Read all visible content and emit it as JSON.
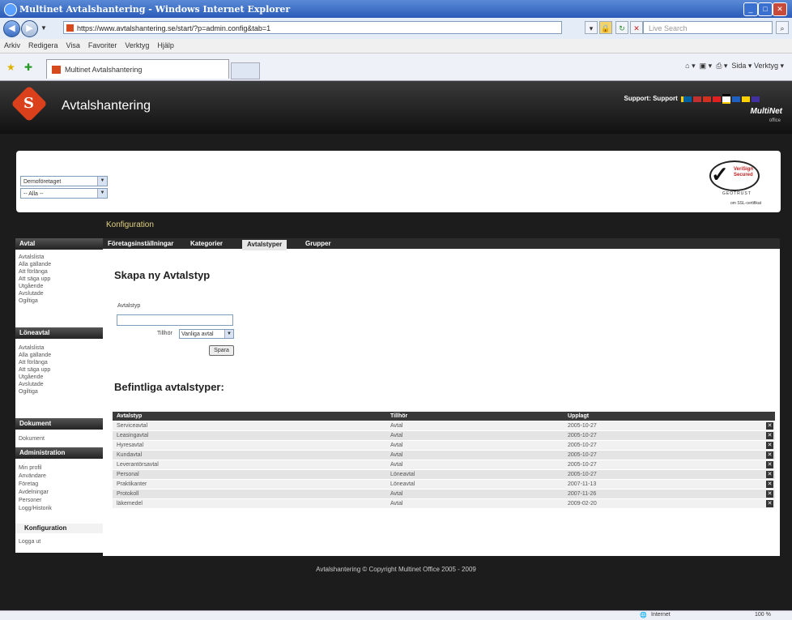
{
  "browser": {
    "window_title": "Multinet Avtalshantering - Windows Internet Explorer",
    "url": "https://www.avtalshantering.se/start/?p=admin.config&tab=1",
    "search_placeholder": "Live Search",
    "menu": [
      "Arkiv",
      "Redigera",
      "Visa",
      "Favoriter",
      "Verktyg",
      "Hjälp"
    ],
    "tab_title": "Multinet Avtalshantering",
    "toolbar_right": "Sida ▾   Verktyg ▾",
    "status_zone": "Internet",
    "zoom": "100 %"
  },
  "header": {
    "app_title": "Avtalshantering",
    "support_label": "Support: Support",
    "brand": "MultiNet",
    "brand_sub": "office"
  },
  "filters": {
    "company": "Demoföretaget",
    "scope": "-- Alla --"
  },
  "verisign": {
    "line1": "VeriSign",
    "line2": "Secured",
    "geo": "GEOTRUST",
    "cert": "om SSL-certifikat"
  },
  "section_title": "Konfiguration",
  "sidebar": {
    "avtal_head": "Avtal",
    "avtal_items": [
      "Avtalslista",
      "Alla gällande",
      "Att förlänga",
      "Att säga upp",
      "Utgående",
      "Avslutade",
      "Ogiltiga"
    ],
    "lone_head": "Löneavtal",
    "lone_items": [
      "Avtalslista",
      "Alla gällande",
      "Att förlänga",
      "Att säga upp",
      "Utgående",
      "Avslutade",
      "Ogiltiga"
    ],
    "dok_head": "Dokument",
    "dok_items": [
      "Dokument"
    ],
    "admin_head": "Administration",
    "admin_items": [
      "Min profil",
      "Användare",
      "Företag",
      "Avdelningar",
      "Personer",
      "Logg/Historik"
    ],
    "active_item": "Konfiguration",
    "logout": "Logga ut"
  },
  "tabs": [
    "Företagsinställningar",
    "Kategorier",
    "Avtalstyper",
    "Grupper"
  ],
  "form": {
    "title": "Skapa ny Avtalstyp",
    "type_label": "Avtalstyp",
    "belongs_label": "Tillhör",
    "belongs_value": "Vanliga avtal",
    "save_label": "Spara"
  },
  "existing": {
    "title": "Befintliga avtalstyper:",
    "columns": [
      "Avtalstyp",
      "Tillhör",
      "Upplagt"
    ],
    "rows": [
      [
        "Serviceavtal",
        "Avtal",
        "2005-10-27"
      ],
      [
        "Leasingavtal",
        "Avtal",
        "2005-10-27"
      ],
      [
        "Hyresavtal",
        "Avtal",
        "2005-10-27"
      ],
      [
        "Kundavtal",
        "Avtal",
        "2005-10-27"
      ],
      [
        "Leverantörsavtal",
        "Avtal",
        "2005-10-27"
      ],
      [
        "Personal",
        "Löneavtal",
        "2005-10-27"
      ],
      [
        "Praktikanter",
        "Löneavtal",
        "2007-11-13"
      ],
      [
        "Protokoll",
        "Avtal",
        "2007-11-26"
      ],
      [
        "läkemedel",
        "Avtal",
        "2009-02-20"
      ]
    ]
  },
  "footer": "Avtalshantering © Copyright Multinet Office 2005 - 2009"
}
